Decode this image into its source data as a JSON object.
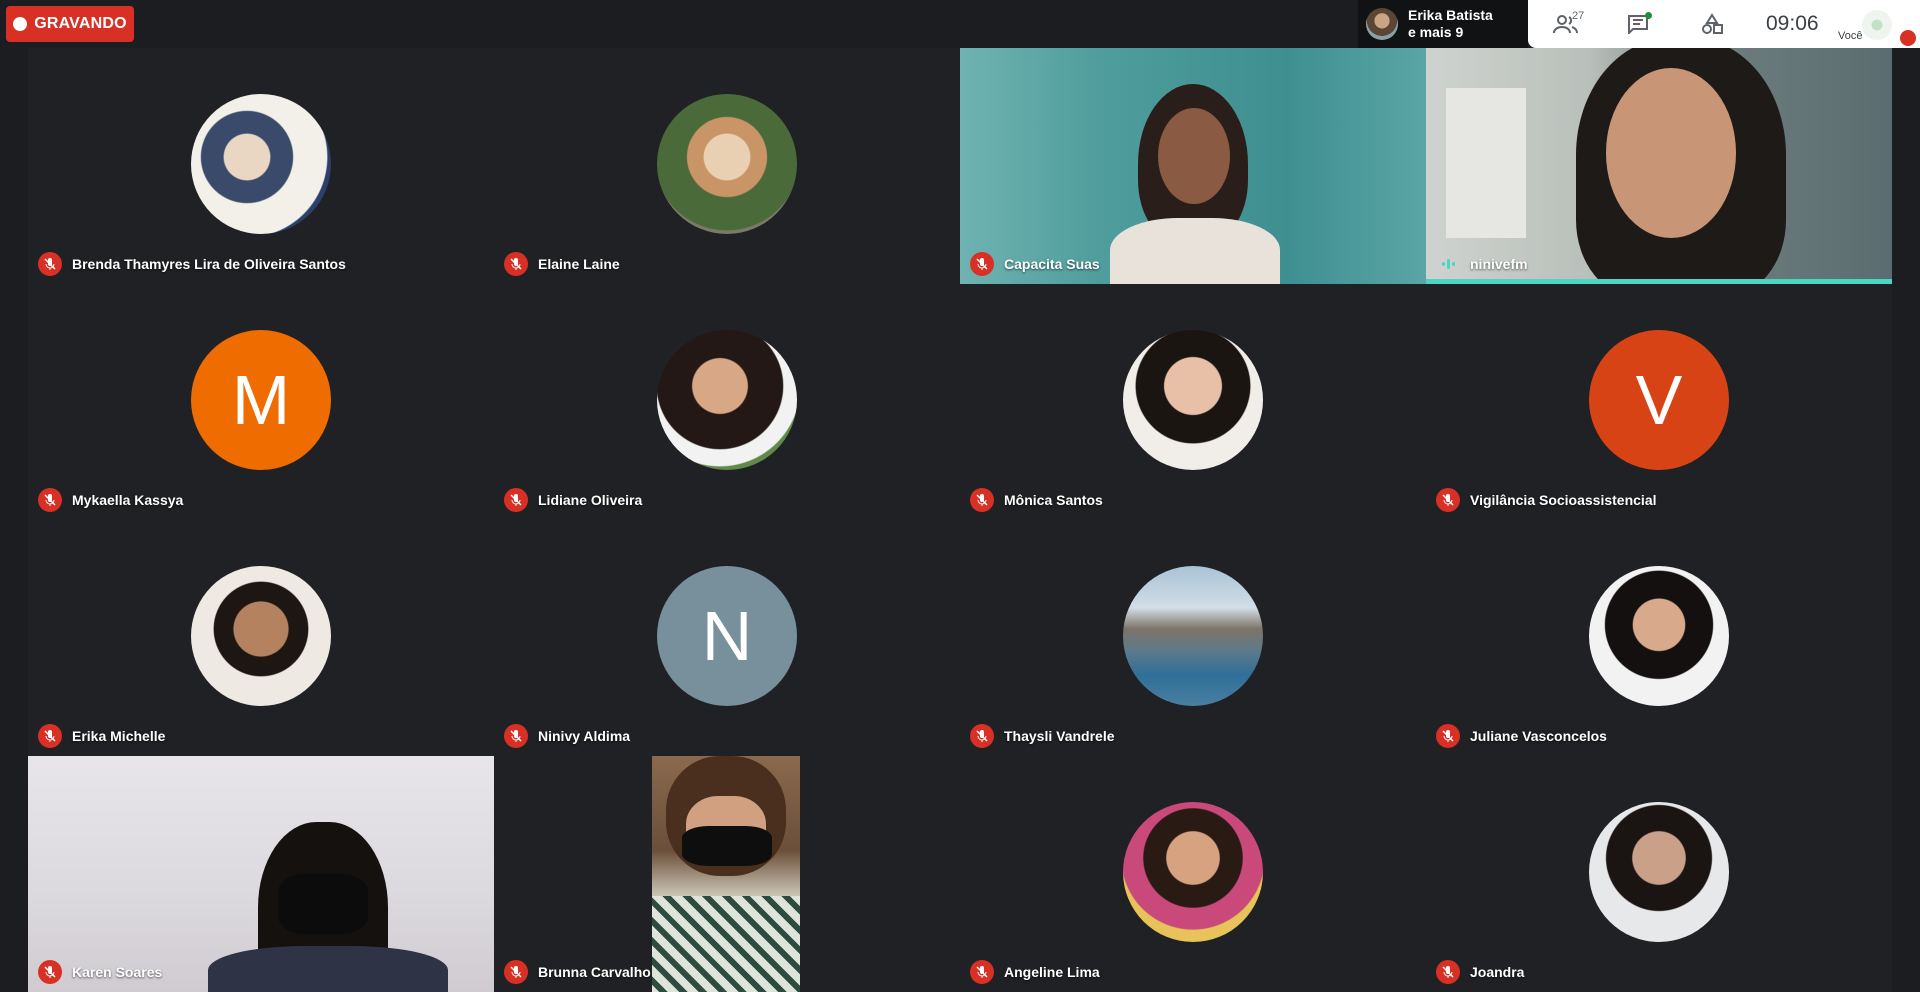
{
  "recording": {
    "label": "GRAVANDO"
  },
  "presenter": {
    "line1": "Erika Batista",
    "line2": "e mais 9"
  },
  "toolbar": {
    "participants_count": "27",
    "clock": "09:06",
    "self_label": "Você"
  },
  "participants": [
    {
      "name": "Brenda Thamyres Lira de Oliveira Santos",
      "muted": true
    },
    {
      "name": "Elaine Laine",
      "muted": true
    },
    {
      "name": "Capacita Suas",
      "muted": true
    },
    {
      "name": "ninivefm",
      "muted": false
    },
    {
      "name": "Mykaella Kassya",
      "muted": true,
      "initial": "M"
    },
    {
      "name": "Lidiane Oliveira",
      "muted": true
    },
    {
      "name": "Mônica Santos",
      "muted": true
    },
    {
      "name": "Vigilância Socioassistencial",
      "muted": true,
      "initial": "V"
    },
    {
      "name": "Erika Michelle",
      "muted": true
    },
    {
      "name": "Ninivy Aldima",
      "muted": true,
      "initial": "N"
    },
    {
      "name": "Thaysli Vandrele",
      "muted": true
    },
    {
      "name": "Juliane Vasconcelos",
      "muted": true
    },
    {
      "name": "Karen Soares",
      "muted": true
    },
    {
      "name": "Brunna Carvalho",
      "muted": true
    },
    {
      "name": "Angeline Lima",
      "muted": true
    },
    {
      "name": "Joandra",
      "muted": true
    }
  ],
  "colors": {
    "mute_red": "#d93025",
    "speaking": "#4cd6c1",
    "avatar_orange": "#ef6c00",
    "avatar_darkorange": "#d84315",
    "avatar_slate": "#78909c"
  }
}
